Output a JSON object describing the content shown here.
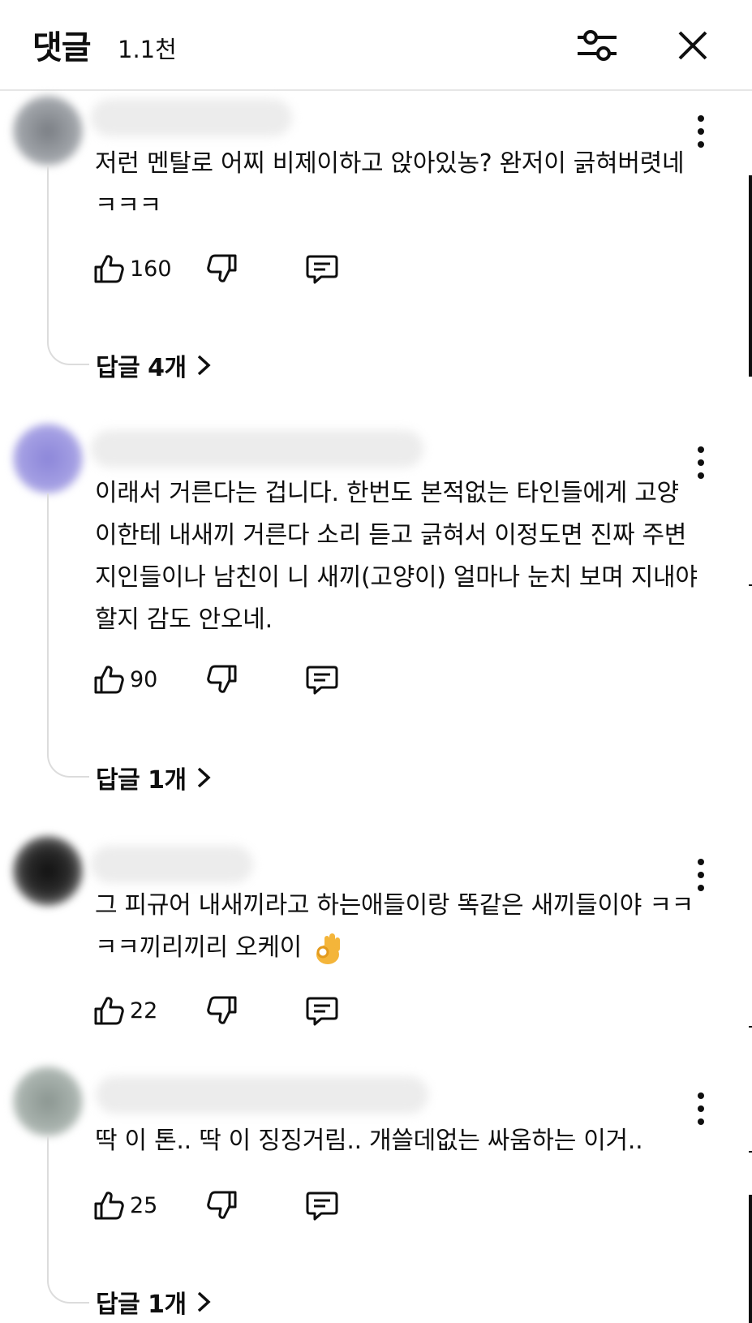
{
  "header": {
    "title": "댓글",
    "count": "1.1천",
    "filter_icon": "sliders-icon",
    "close_icon": "close-icon"
  },
  "comments": [
    {
      "text": "저런 멘탈로 어찌 비제이하고 앉아있농? 완저이 긁혀버렷네 ㅋㅋㅋ",
      "likes": "160",
      "replies_label": "답글 4개"
    },
    {
      "text": "이래서 거른다는 겁니다. 한번도 본적없는 타인들에게 고양이한테 내새끼 거른다 소리 듣고 긁혀서 이정도면 진짜 주변 지인들이나 남친이 니 새끼(고양이) 얼마나 눈치 보며 지내야 할지 감도 안오네.",
      "likes": "90",
      "replies_label": "답글 1개"
    },
    {
      "text": "그 피규어 내새끼라고 하는애들이랑 똑같은 새끼들이야 ㅋㅋㅋㅋ끼리끼리 오케이",
      "likes": "22",
      "emoji": "ok-hand-emoji"
    },
    {
      "text": "딱 이 톤.. 딱 이 징징거림.. 개쓸데없는 싸움하는 이거..",
      "likes": "25",
      "replies_label": "답글 1개"
    }
  ],
  "colors": {
    "text": "#0f0f0f",
    "divider": "#e6e6e6",
    "thread_line": "#dcdcdc"
  }
}
